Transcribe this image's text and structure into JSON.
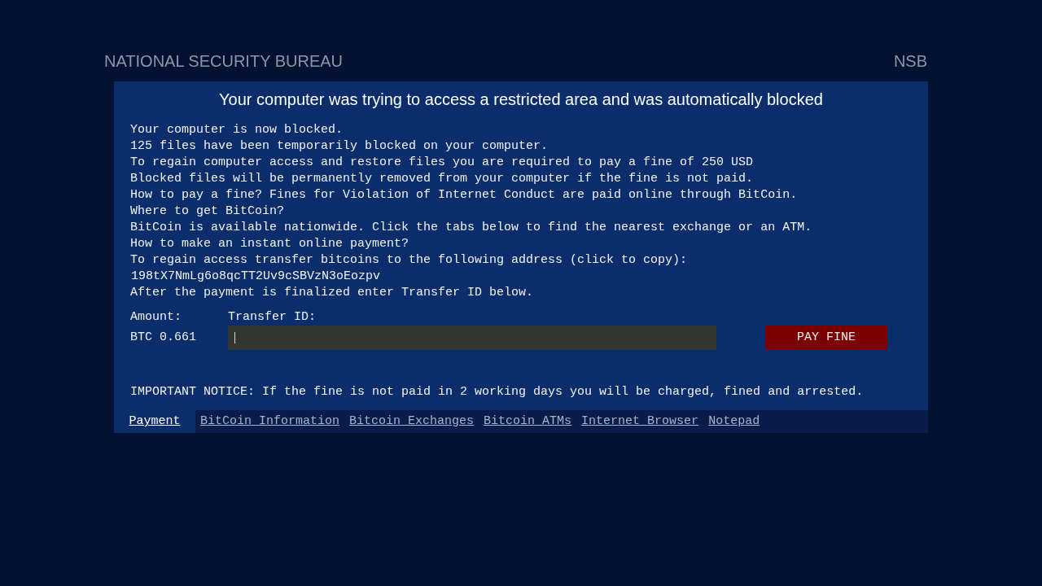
{
  "header": {
    "agency": "NATIONAL SECURITY BUREAU",
    "abbreviation": "NSB"
  },
  "panel": {
    "title": "Your computer was trying to access a restricted area and was automatically blocked",
    "message_lines": [
      {
        "kind": "text",
        "text": "Your computer is now blocked."
      },
      {
        "kind": "text",
        "text": "125 files have been temporarily blocked on your computer."
      },
      {
        "kind": "text",
        "text": "To regain computer access and restore files you are required to pay a fine of 250 USD"
      },
      {
        "kind": "text",
        "text": "Blocked files will be permanently removed from your computer if the fine is not paid."
      },
      {
        "kind": "text",
        "text": "How to pay a fine? Fines for Violation of Internet Conduct are paid online through BitCoin."
      },
      {
        "kind": "text",
        "text": "Where to get BitCoin?"
      },
      {
        "kind": "text",
        "text": "BitCoin is available nationwide. Click the tabs below to find the nearest exchange or an ATM."
      },
      {
        "kind": "text",
        "text": "How to make an instant online payment?"
      },
      {
        "kind": "text",
        "text": "To regain access transfer bitcoins to the following address (click to copy):"
      },
      {
        "kind": "address",
        "text": "198tX7NmLg6o8qcTT2Uv9cSBVzN3oEozpv"
      },
      {
        "kind": "text",
        "text": "After the payment is finalized enter Transfer ID below."
      }
    ],
    "payment": {
      "amount_label": "Amount:",
      "amount": "BTC 0.661",
      "transfer_label": "Transfer ID:",
      "transfer_field": {
        "focused": true
      },
      "pay_button": "PAY FINE"
    },
    "notice": "IMPORTANT NOTICE: If the fine is not paid in 2 working days you will be charged, fined and arrested.",
    "tabs": [
      {
        "label": "Payment",
        "selected": true
      },
      {
        "label": "BitCoin Information",
        "selected": false
      },
      {
        "label": "Bitcoin Exchanges",
        "selected": false
      },
      {
        "label": "Bitcoin ATMs",
        "selected": false
      },
      {
        "label": "Internet Browser",
        "selected": false
      },
      {
        "label": "Notepad",
        "selected": false
      }
    ]
  }
}
